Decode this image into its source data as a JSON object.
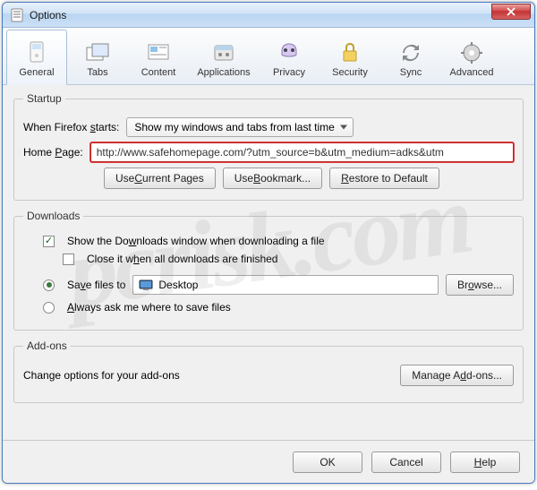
{
  "window": {
    "title": "Options"
  },
  "tabs": {
    "general": "General",
    "tabs": "Tabs",
    "content": "Content",
    "applications": "Applications",
    "privacy": "Privacy",
    "security": "Security",
    "sync": "Sync",
    "advanced": "Advanced"
  },
  "startup": {
    "legend": "Startup",
    "when_label": "When Firefox starts:",
    "when_value": "Show my windows and tabs from last time",
    "homepage_label": "Home Page:",
    "homepage_value": "http://www.safehomepage.com/?utm_source=b&utm_medium=adks&utm",
    "use_current": "Use Current Pages",
    "use_bookmark": "Use Bookmark...",
    "restore_default": "Restore to Default"
  },
  "downloads": {
    "legend": "Downloads",
    "show_window": "Show the Downloads window when downloading a file",
    "close_when_done": "Close it when all downloads are finished",
    "save_to": "Save files to",
    "save_path": "Desktop",
    "browse": "Browse...",
    "always_ask": "Always ask me where to save files"
  },
  "addons": {
    "legend": "Add-ons",
    "change_text": "Change options for your add-ons",
    "manage": "Manage Add-ons..."
  },
  "footer": {
    "ok": "OK",
    "cancel": "Cancel",
    "help": "Help"
  },
  "watermark": "pcrisk.com"
}
